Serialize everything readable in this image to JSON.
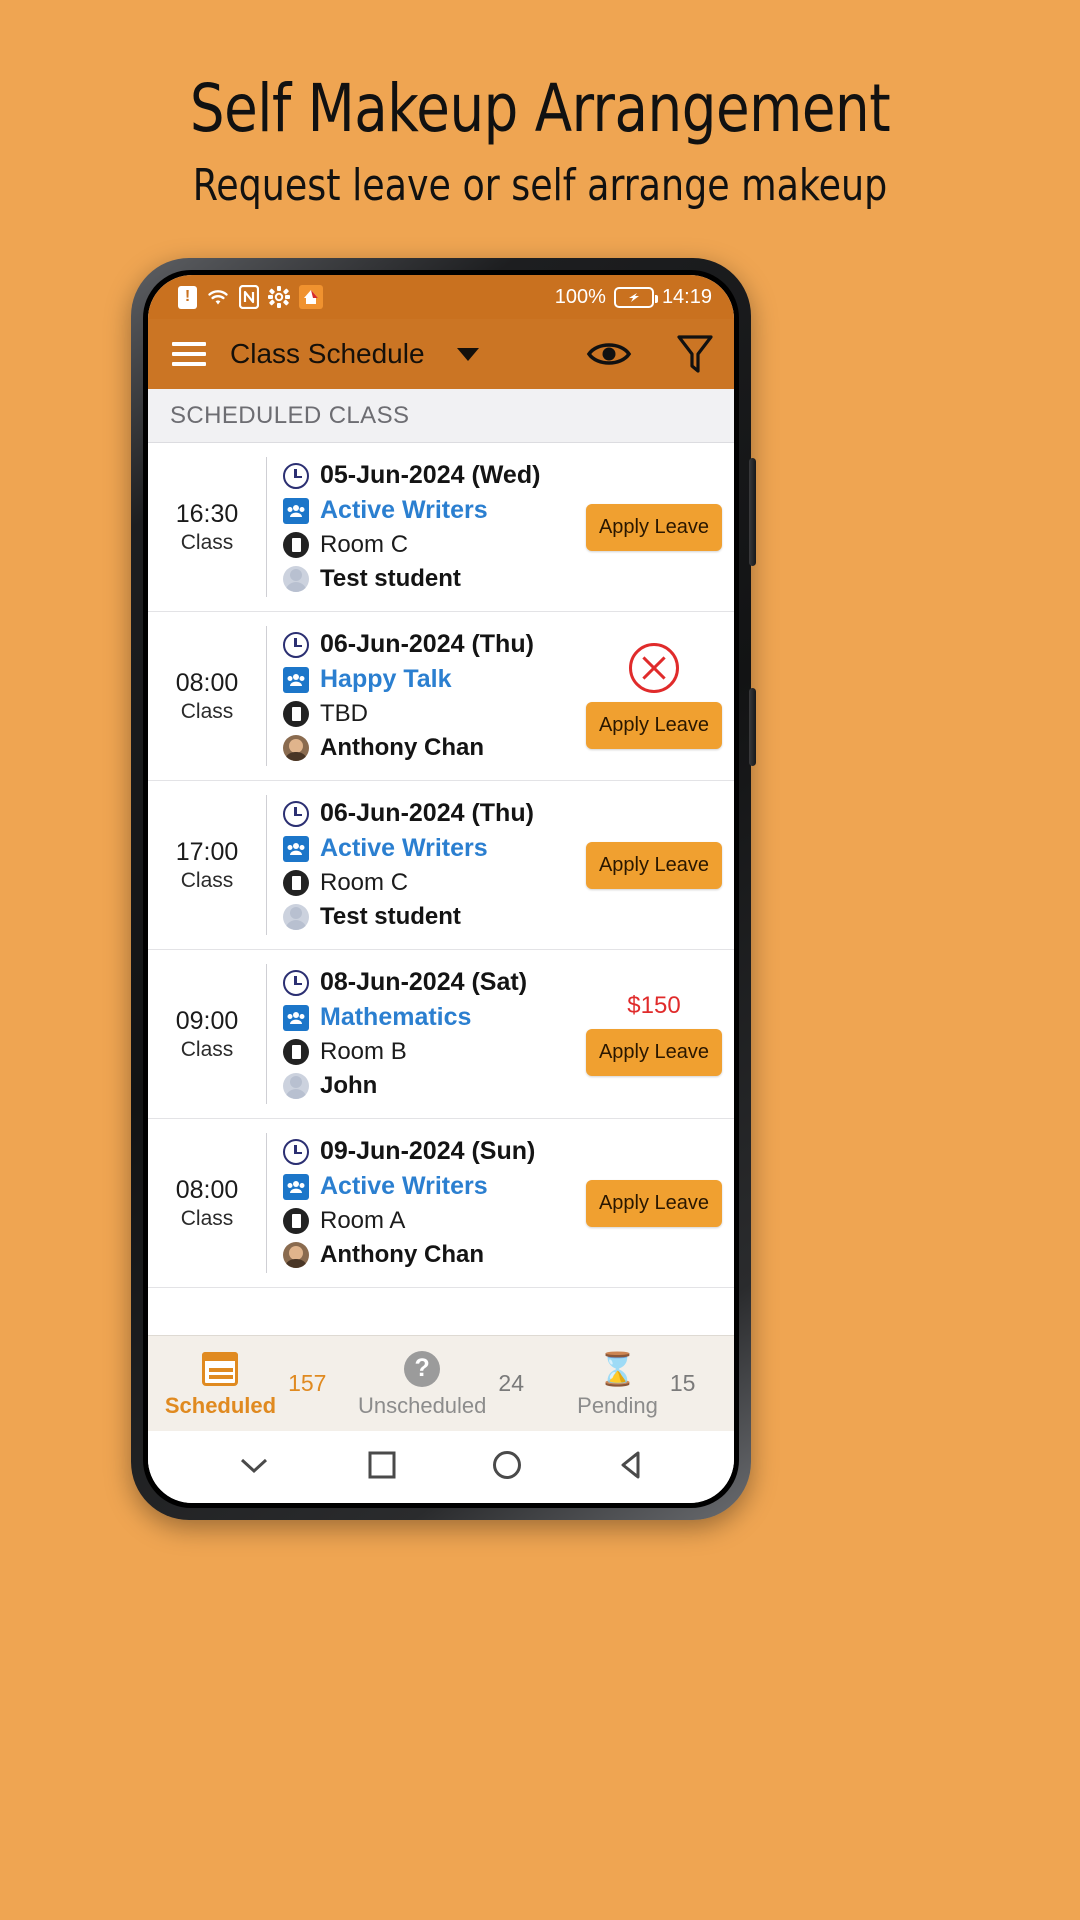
{
  "promo": {
    "title": "Self Makeup Arrangement",
    "subtitle": "Request leave or self arrange makeup",
    "background_color": "#efa552"
  },
  "statusbar": {
    "battery_percent": "100%",
    "time": "14:19",
    "icons": [
      "alert-badge-icon",
      "wifi-icon",
      "nfc-icon",
      "gear-icon",
      "app-icon",
      "battery-charging-icon"
    ]
  },
  "appbar": {
    "title": "Class Schedule",
    "menu_icon": "hamburger-icon",
    "dropdown_icon": "caret-down-icon",
    "eye_icon": "eye-icon",
    "filter_icon": "filter-funnel-icon",
    "background_color": "#cb7524"
  },
  "section": {
    "header": "SCHEDULED CLASS"
  },
  "list": {
    "apply_leave_label": "Apply Leave",
    "class_label": "Class",
    "rows": [
      {
        "time": "16:30",
        "type": "Class",
        "date": "05-Jun-2024 (Wed)",
        "class_name": "Active Writers",
        "room": "Room C",
        "student": "Test student",
        "student_avatar": "generic",
        "action": "apply-leave",
        "price": null
      },
      {
        "time": "08:00",
        "type": "Class",
        "date": "06-Jun-2024 (Thu)",
        "class_name": "Happy Talk",
        "room": "TBD",
        "student": "Anthony Chan",
        "student_avatar": "photo",
        "action": "cancel-and-apply-leave",
        "price": null
      },
      {
        "time": "17:00",
        "type": "Class",
        "date": "06-Jun-2024 (Thu)",
        "class_name": "Active Writers",
        "room": "Room C",
        "student": "Test student",
        "student_avatar": "generic",
        "action": "apply-leave",
        "price": null
      },
      {
        "time": "09:00",
        "type": "Class",
        "date": "08-Jun-2024 (Sat)",
        "class_name": "Mathematics",
        "room": "Room B",
        "student": "John",
        "student_avatar": "generic",
        "action": "price-and-apply-leave",
        "price": "$150"
      },
      {
        "time": "08:00",
        "type": "Class",
        "date": "09-Jun-2024 (Sun)",
        "class_name": "Active Writers",
        "room": "Room A",
        "student": "Anthony Chan",
        "student_avatar": "photo",
        "action": "apply-leave",
        "price": null
      }
    ]
  },
  "tabs": [
    {
      "label": "Scheduled",
      "count": "157",
      "icon": "calendar-icon",
      "active": true
    },
    {
      "label": "Unscheduled",
      "count": "24",
      "icon": "question-icon",
      "active": false
    },
    {
      "label": "Pending",
      "count": "15",
      "icon": "hourglass-icon",
      "active": false
    }
  ],
  "navbar": {
    "items": [
      "chevron-down-icon",
      "square-icon",
      "circle-icon",
      "triangle-back-icon"
    ]
  },
  "colors": {
    "accent_orange": "#f0a030",
    "appbar_orange": "#cb7524",
    "link_blue": "#2b7fd0",
    "danger_red": "#e02b2b"
  }
}
